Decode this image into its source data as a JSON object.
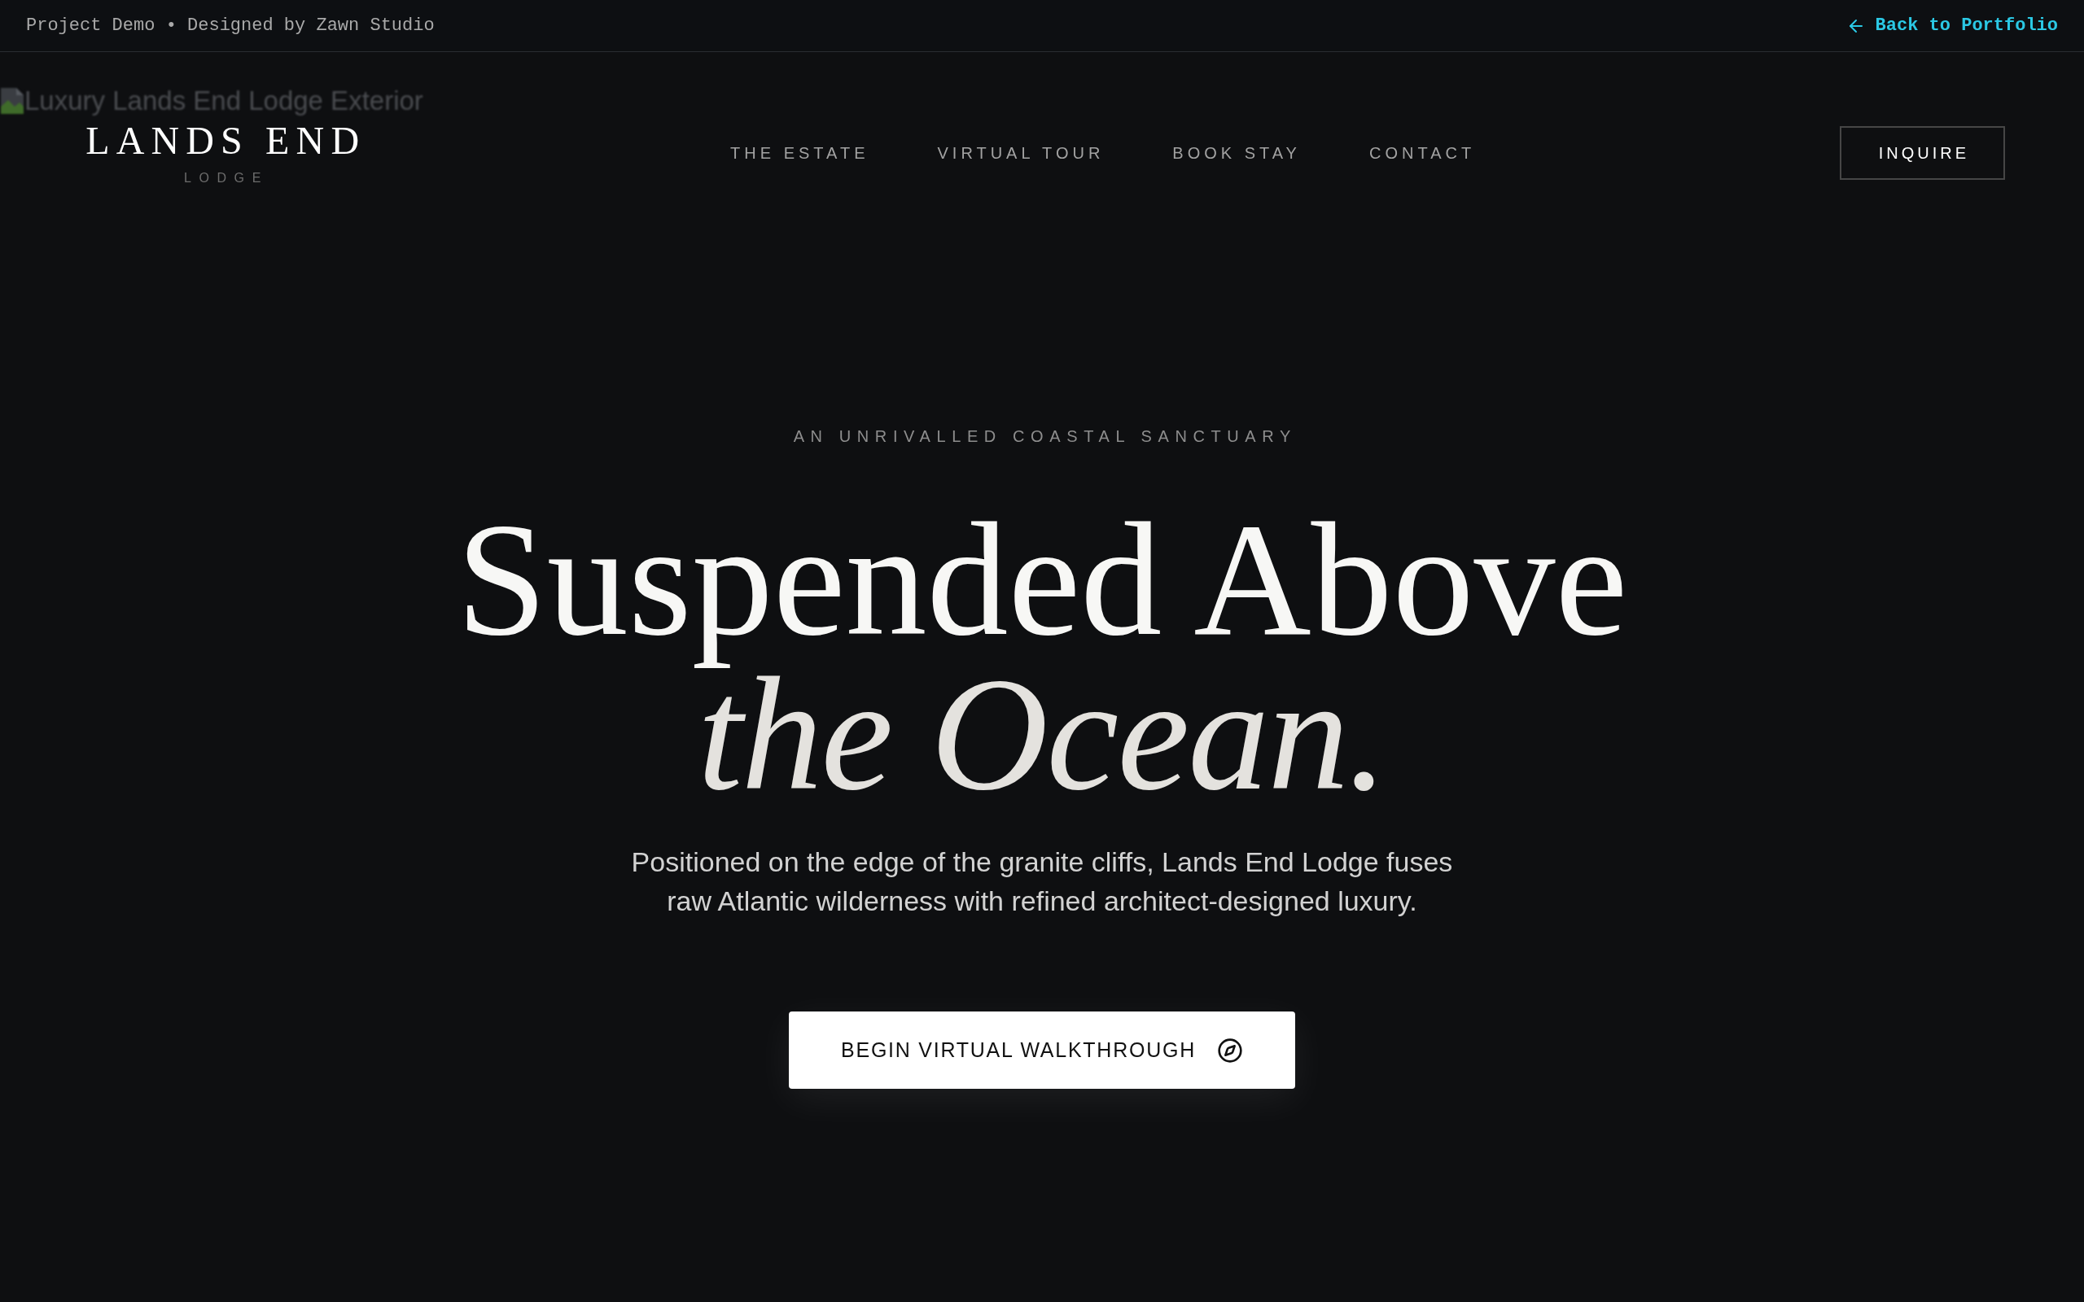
{
  "top_bar": {
    "credit": "Project Demo • Designed by Zawn Studio",
    "back_link": "Back to Portfolio"
  },
  "header": {
    "image_alt": "Luxury Lands End Lodge Exterior",
    "logo": {
      "title": "LANDS END",
      "subtitle": "LODGE"
    },
    "nav": [
      "THE ESTATE",
      "VIRTUAL TOUR",
      "BOOK STAY",
      "CONTACT"
    ],
    "inquire_button": "INQUIRE"
  },
  "hero": {
    "kicker": "AN UNRIVALLED COASTAL SANCTUARY",
    "headline": {
      "lead": "Suspended Above",
      "emphasis": "the Ocean."
    },
    "description": "Positioned on the edge of the granite cliffs, Lands End Lodge fuses raw Atlantic wilderness with refined architect-designed luxury.",
    "cta_button": "BEGIN VIRTUAL WALKTHROUGH"
  }
}
